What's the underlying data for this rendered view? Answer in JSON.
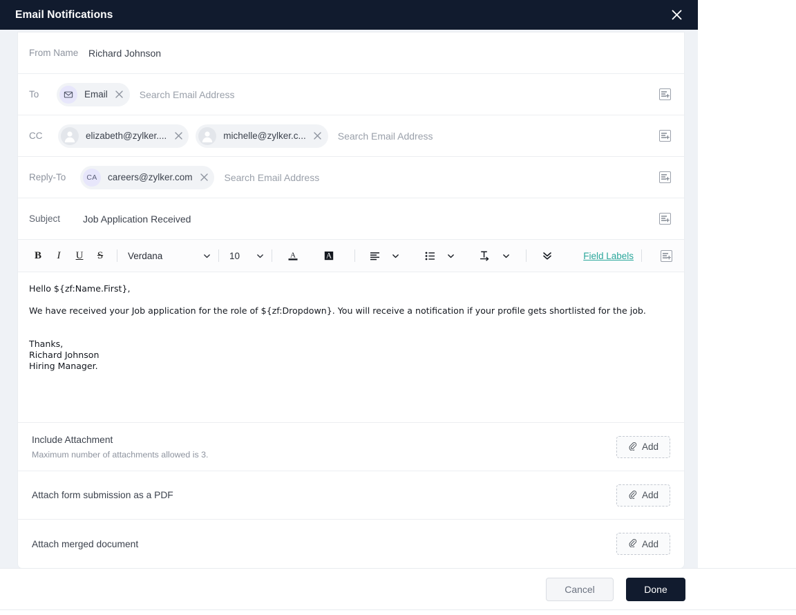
{
  "modal": {
    "title": "Email Notifications",
    "close_icon": "close-icon"
  },
  "fields": {
    "from": {
      "label": "From Name",
      "value": "Richard Johnson"
    },
    "to": {
      "label": "To",
      "placeholder": "Search Email Address",
      "chips": [
        {
          "text": "Email",
          "avatar_type": "envelope",
          "avatar_initials": ""
        }
      ]
    },
    "cc": {
      "label": "CC",
      "placeholder": "Search Email Address",
      "chips": [
        {
          "text": "elizabeth@zylker....",
          "avatar_type": "person",
          "avatar_initials": ""
        },
        {
          "text": "michelle@zylker.c...",
          "avatar_type": "person",
          "avatar_initials": ""
        }
      ]
    },
    "reply_to": {
      "label": "Reply-To",
      "placeholder": "Search Email Address",
      "chips": [
        {
          "text": "careers@zylker.com",
          "avatar_type": "initials",
          "avatar_initials": "CA"
        }
      ]
    },
    "subject": {
      "label": "Subject",
      "value": "Job Application Received"
    }
  },
  "merge_icon_name": "merge-field-icon",
  "toolbar": {
    "bold": "B",
    "italic": "I",
    "underline": "U",
    "strikethrough": "S",
    "font_family": "Verdana",
    "font_size": "10",
    "text_color_icon": "text-color-icon",
    "highlight_color_icon": "highlight-color-icon",
    "align_icon": "align-left-icon",
    "list_icon": "bulleted-list-icon",
    "indent_icon": "indent-icon",
    "more_icon": "more-options-icon",
    "field_labels": "Field Labels",
    "merge_icon": "merge-field-icon"
  },
  "body": {
    "greeting": "Hello ${zf:Name.First},",
    "paragraph": "We have received your Job application for the role of ${zf:Dropdown}. You will receive a notification if your profile gets shortlisted for the job.",
    "sign_off": "Thanks,",
    "sign_name": "Richard Johnson",
    "sign_role": "Hiring Manager."
  },
  "attachments": [
    {
      "title": "Include Attachment",
      "subtitle": "Maximum number of attachments allowed is 3.",
      "button_label": "Add"
    },
    {
      "title": "Attach form submission as a PDF",
      "subtitle": "",
      "button_label": "Add"
    },
    {
      "title": "Attach merged document",
      "subtitle": "",
      "button_label": "Add"
    }
  ],
  "footer": {
    "cancel_label": "Cancel",
    "done_label": "Done"
  },
  "colors": {
    "header_bg": "#111b2e",
    "modal_bg": "#eff2f6",
    "accent_link": "#2aa79b",
    "primary_button": "#111b2e",
    "chip_bg": "#f1f3f6",
    "avatar_purple": "#e7e6fb"
  }
}
